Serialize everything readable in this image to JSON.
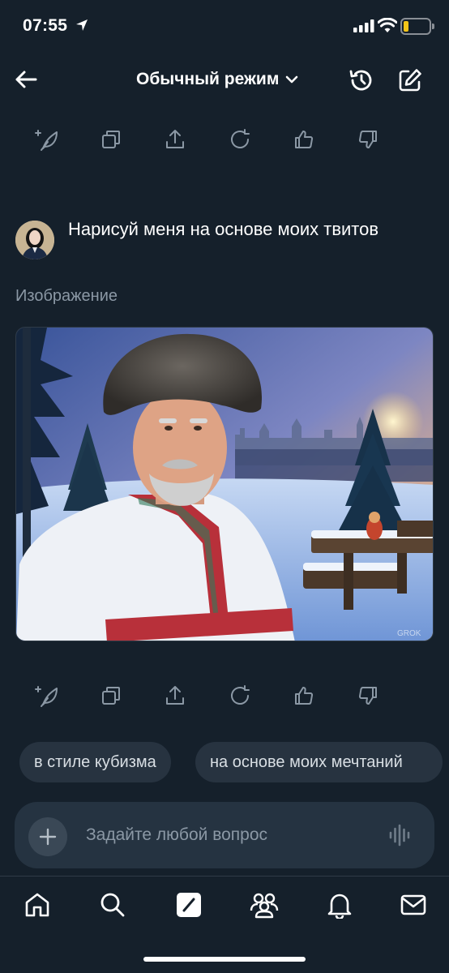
{
  "status_bar": {
    "time": "07:55",
    "battery_level": 0.2,
    "battery_color": "#f5c518"
  },
  "header": {
    "back_icon": "arrow-left-icon",
    "mode_label": "Обычный режим",
    "mode_dropdown_icon": "chevron-down-icon",
    "history_icon": "history-icon",
    "new_chat_icon": "compose-icon"
  },
  "action_row_icons": [
    "regenerate-sparkle-icon",
    "copy-icon",
    "share-icon",
    "refresh-icon",
    "thumbs-up-icon",
    "thumbs-down-icon"
  ],
  "message": {
    "user_text": "Нарисуй меня на основе моих твитов",
    "result_label": "Изображение",
    "image_watermark": "GROK"
  },
  "suggestions": {
    "chip_1": "в стиле кубизма",
    "chip_2": "на основе моих мечтаний"
  },
  "input": {
    "placeholder": "Задайте любой вопрос",
    "plus_icon": "plus-icon",
    "voice_icon": "voice-waveform-icon"
  },
  "bottom_nav": [
    "home-icon",
    "search-icon",
    "grok-icon",
    "communities-icon",
    "notifications-icon",
    "messages-icon"
  ],
  "colors": {
    "background": "#15202b",
    "secondary_text": "#8b98a5",
    "chip_background": "#273340",
    "input_background": "#253341"
  }
}
